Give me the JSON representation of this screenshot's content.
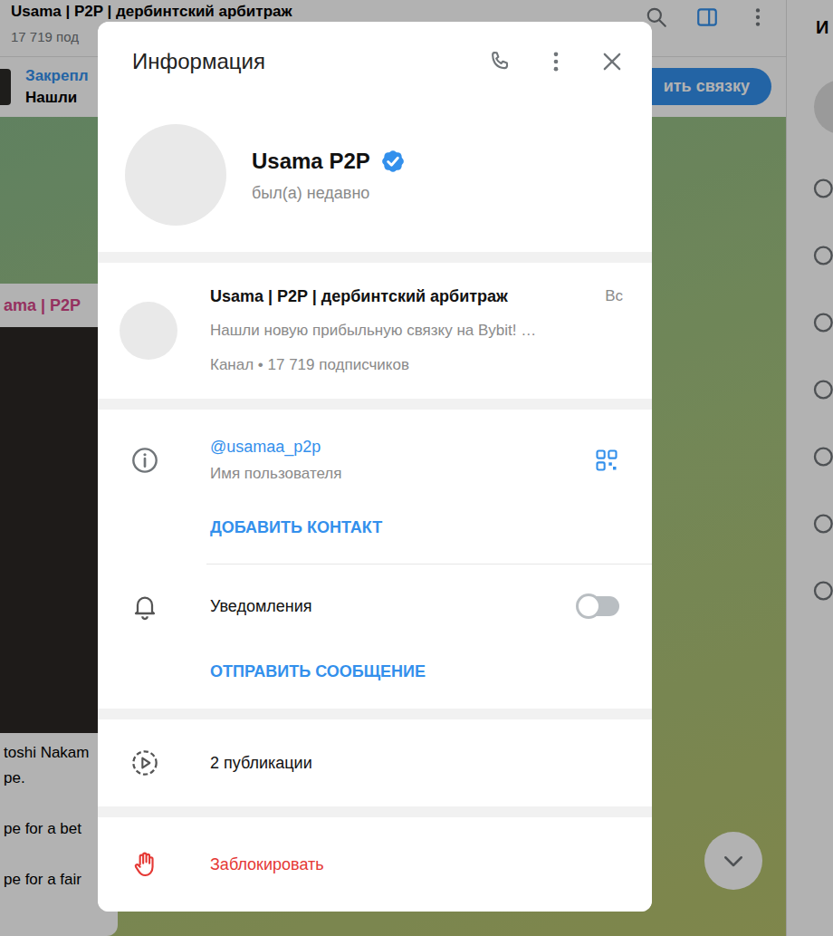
{
  "channel_header": {
    "title": "Usama | P2P | дербинтский арбитраж",
    "subtitle": "17 719 под"
  },
  "pinned": {
    "label": "Закрепл",
    "text": "Нашли",
    "button": "ить связку"
  },
  "message": {
    "author": "ama | P2P",
    "paragraphs": [
      [
        "toshi Nakam",
        "pe."
      ],
      [
        "pe for a bet"
      ],
      [
        "pe for a fair"
      ]
    ]
  },
  "right_panel": {
    "title": "И"
  },
  "dialog": {
    "title": "Информация",
    "profile": {
      "name": "Usama P2P",
      "verified": true,
      "status": "был(а) недавно"
    },
    "linked_channel": {
      "title": "Usama | P2P | дербинтский арбитраж",
      "date": "Вс",
      "preview": "Нашли новую прибыльную связку на Bybit! …",
      "meta": "Канал • 17 719 подписчиков"
    },
    "username": {
      "value": "@usamaa_p2p",
      "label": "Имя пользователя"
    },
    "add_contact": "ДОБАВИТЬ КОНТАКТ",
    "notifications": {
      "label": "Уведомления",
      "on": false
    },
    "send_message": "ОТПРАВИТЬ СООБЩЕНИЕ",
    "stories": "2 публикации",
    "block": "Заблокировать"
  }
}
